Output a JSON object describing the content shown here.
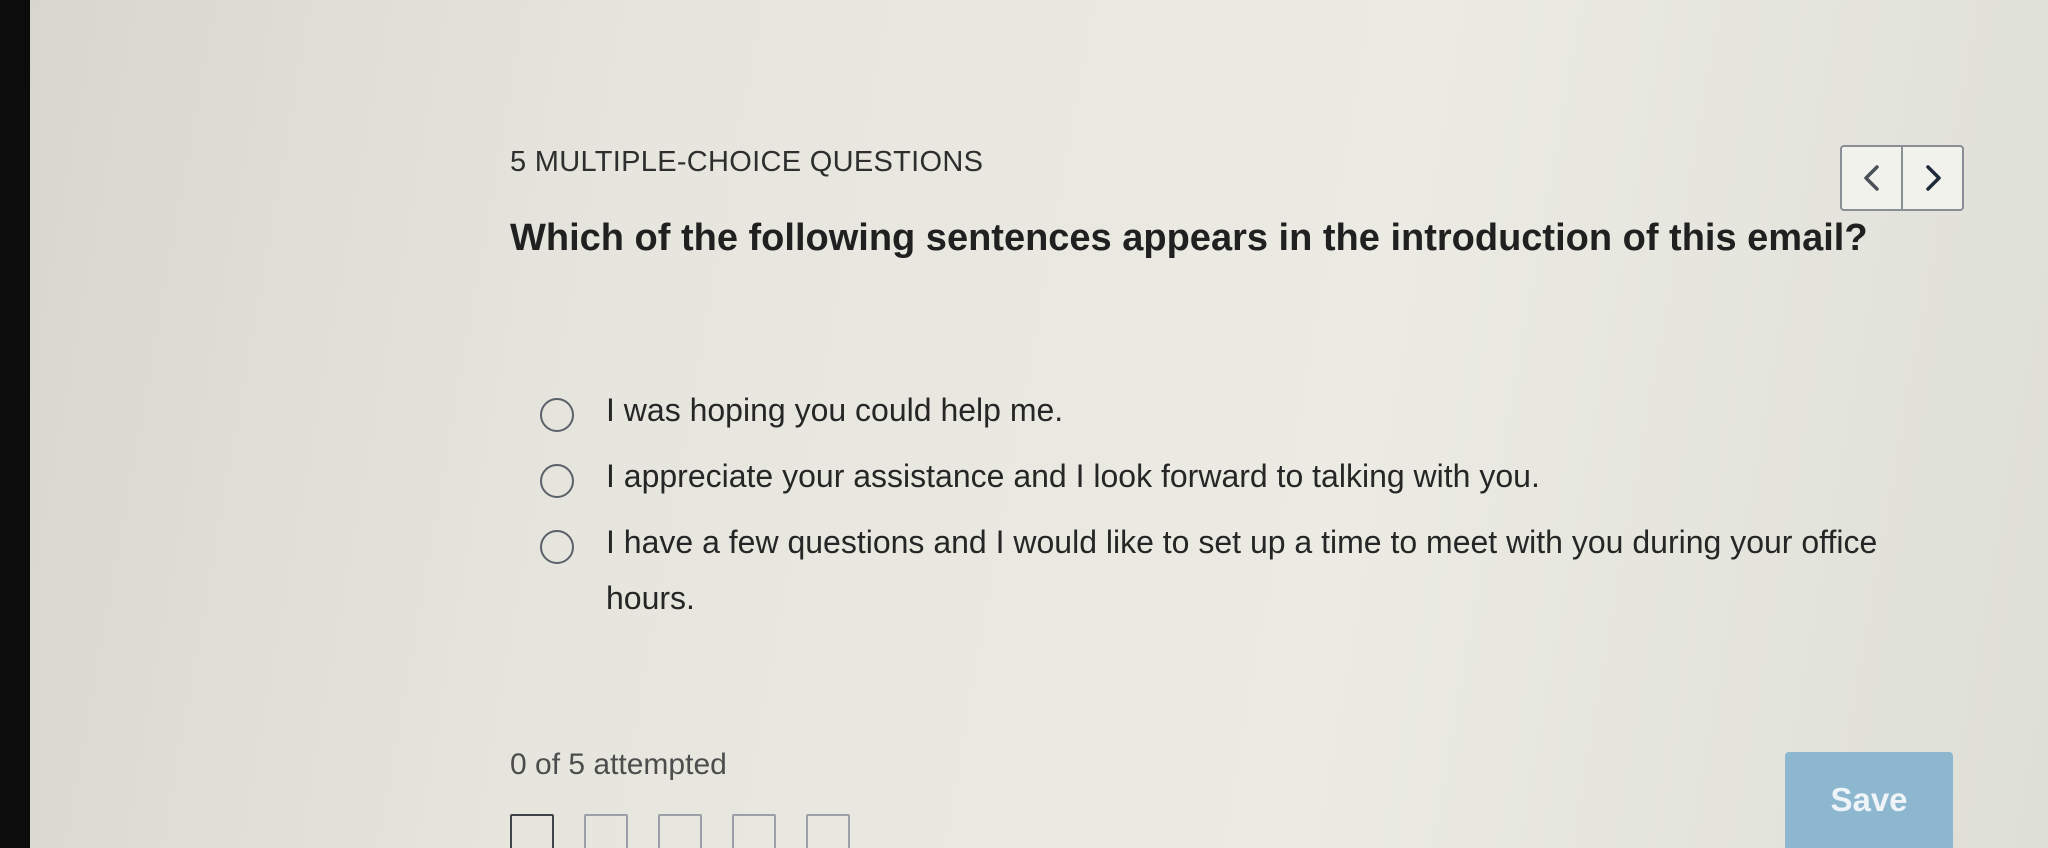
{
  "header": {
    "title": "5 MULTIPLE-CHOICE QUESTIONS"
  },
  "nav": {
    "prev_icon": "chevron-left-icon",
    "next_icon": "chevron-right-icon"
  },
  "question": {
    "text": "Which of the following sentences appears in the introduction of this email?",
    "options": [
      {
        "label": "I was hoping you could help me.",
        "selected": false
      },
      {
        "label": "I appreciate your assistance and I look forward to talking with you.",
        "selected": false
      },
      {
        "label": "I have a few questions and I would like to set up a time to meet with you during your office hours.",
        "selected": false
      }
    ]
  },
  "progress": {
    "text": "0 of 5 attempted",
    "attempted": 0,
    "total": 5
  },
  "actions": {
    "save_label": "Save"
  },
  "colors": {
    "accent": "#8cb7ce"
  }
}
